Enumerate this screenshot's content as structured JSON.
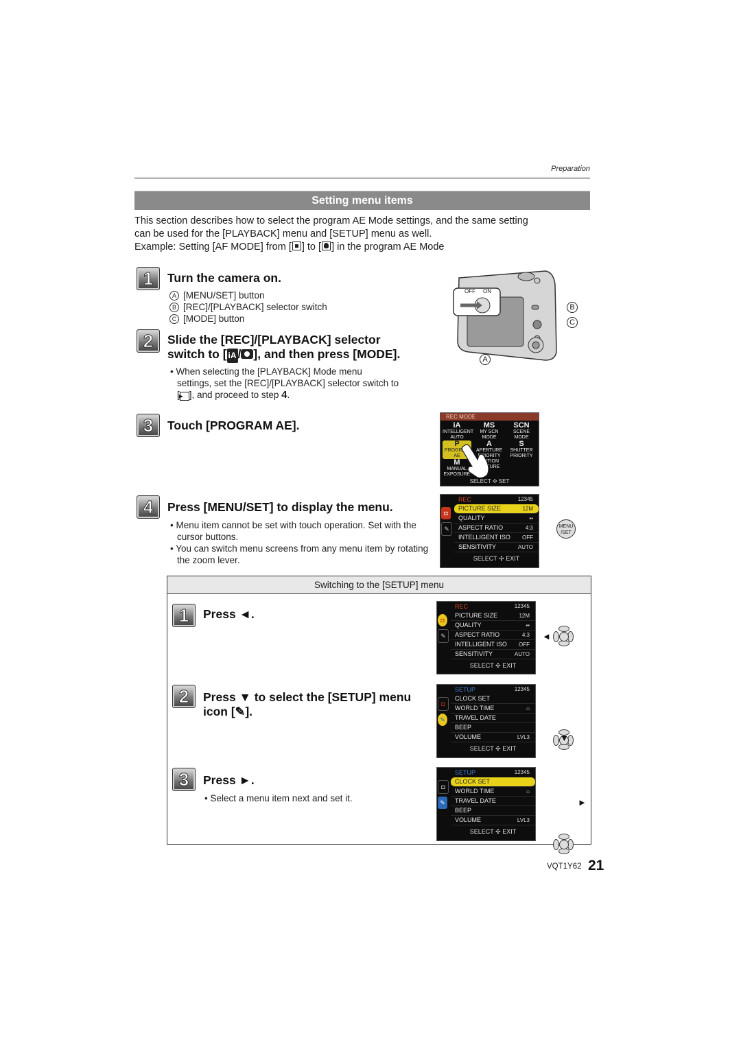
{
  "header": {
    "running_head": "Preparation",
    "section_title": "Setting menu items"
  },
  "intro": {
    "line1": "This section describes how to select the program AE Mode settings, and the same setting",
    "line2": "can be used for the [PLAYBACK] menu and [SETUP] menu as well.",
    "example_prefix": "Example: Setting [AF MODE] from [",
    "example_mid": "] to [",
    "example_suffix": "] in the program AE Mode",
    "icons": [
      "af-1-area-icon",
      "af-face-detection-icon"
    ]
  },
  "steps": [
    {
      "number": "1",
      "title": "Turn the camera on.",
      "callouts": [
        {
          "key": "A",
          "label": "[MENU/SET] button"
        },
        {
          "key": "B",
          "label": "[REC]/[PLAYBACK] selector switch"
        },
        {
          "key": "C",
          "label": "[MODE] button"
        }
      ]
    },
    {
      "number": "2",
      "title_line1": "Slide the [REC]/[PLAYBACK] selector",
      "title_line2_prefix": "switch to [",
      "title_line2_suffix": "], and then press [MODE].",
      "icon_ia": "iA",
      "notes": {
        "line1": "When selecting the [PLAYBACK] Mode menu",
        "line2": "settings, set the [REC]/[PLAYBACK] selector switch to",
        "line3_prefix": "[",
        "line3_mid": "], and proceed to step ",
        "line3_step": "4",
        "line3_suffix": "."
      }
    },
    {
      "number": "3",
      "title": "Touch [PROGRAM AE]."
    },
    {
      "number": "4",
      "title": "Press [MENU/SET] to display the menu.",
      "notes": [
        "Menu item cannot be set with touch operation. Set with the cursor buttons.",
        "You can switch menu screens from any menu item by rotating the zoom lever."
      ]
    }
  ],
  "camera_figure": {
    "switch_off": "OFF",
    "switch_on": "ON",
    "labels": [
      "A",
      "B",
      "C"
    ]
  },
  "rec_mode_screen": {
    "title": "REC MODE",
    "cells": [
      {
        "icon": "iA",
        "label1": "INTELLIGENT",
        "label2": "AUTO"
      },
      {
        "icon": "MS",
        "label1": "MY SCN",
        "label2": "MODE"
      },
      {
        "icon": "SCN",
        "label1": "SCENE",
        "label2": "MODE"
      },
      {
        "icon": "P",
        "label1": "PROGRAM",
        "label2": "AE"
      },
      {
        "icon": "A",
        "label1": "APERTURE",
        "label2": "PRIORITY"
      },
      {
        "icon": "S",
        "label1": "SHUTTER",
        "label2": "PRIORITY"
      },
      {
        "icon": "M",
        "label1": "MANUAL",
        "label2": "EXPOSURE"
      },
      {
        "icon": "",
        "label1": "MOTION",
        "label2": "PICTURE"
      }
    ],
    "footer": "SELECT ✣ SET"
  },
  "rec_menu": {
    "title": "REC",
    "pages": "12345",
    "items": [
      {
        "label": "PICTURE SIZE",
        "value": "12M"
      },
      {
        "label": "QUALITY",
        "value": "▪▪"
      },
      {
        "label": "ASPECT RATIO",
        "value": "4:3"
      },
      {
        "label": "INTELLIGENT ISO",
        "value": "OFF"
      },
      {
        "label": "SENSITIVITY",
        "value": "AUTO"
      }
    ],
    "footer": "SELECT ✣ EXIT"
  },
  "setup_menu": {
    "title": "SETUP",
    "pages": "12345",
    "items": [
      {
        "label": "CLOCK SET",
        "value": ""
      },
      {
        "label": "WORLD TIME",
        "value": "⌂"
      },
      {
        "label": "TRAVEL DATE",
        "value": ""
      },
      {
        "label": "BEEP",
        "value": ""
      },
      {
        "label": "VOLUME",
        "value": "LVL3"
      }
    ],
    "footer": "SELECT ✣ EXIT"
  },
  "menu_button": {
    "line1": "MENU",
    "line2": "/SET"
  },
  "setup_box": {
    "heading": "Switching to the [SETUP] menu",
    "steps": [
      {
        "number": "1",
        "title": "Press ◄."
      },
      {
        "number": "2",
        "title_line1": "Press ▼ to select the [SETUP] menu",
        "title_line2": "icon [",
        "title_line2_suffix": "]."
      },
      {
        "number": "3",
        "title": "Press ►.",
        "note": "Select a menu item next and set it."
      }
    ],
    "arrows": {
      "left": "◄",
      "down": "▼",
      "right": "►"
    }
  },
  "footer": {
    "code": "VQT1Y62",
    "page": "21"
  }
}
